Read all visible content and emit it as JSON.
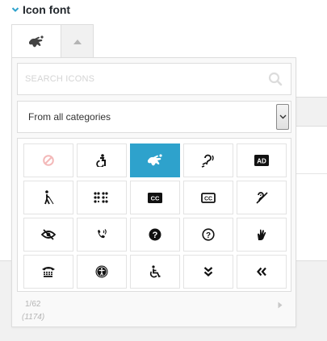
{
  "section": {
    "title": "Icon font"
  },
  "selector": {
    "current_icon": "sign-language-icon"
  },
  "search": {
    "placeholder": "SEARCH ICONS",
    "value": ""
  },
  "category": {
    "selected": "From all categories"
  },
  "icons": [
    "ban-icon",
    "accessible-person-icon",
    "sign-language-icon",
    "assistive-listening-icon",
    "audio-description-icon",
    "blind-icon",
    "braille-icon",
    "closed-captioning-icon",
    "closed-captioning-outline-icon",
    "deaf-icon",
    "low-vision-icon",
    "volume-control-phone-icon",
    "question-circle-icon",
    "question-circle-outline-icon",
    "sign-language-hand-icon",
    "tty-icon",
    "universal-access-icon",
    "wheelchair-icon",
    "angle-double-down-icon",
    "angle-double-left-icon"
  ],
  "selected_icon": "sign-language-icon",
  "pager": {
    "page": "1/62",
    "total": "(1174)"
  },
  "colors": {
    "accent": "#2ea2cc",
    "section_chevron": "#2ea2cc",
    "disabled_icon": "#f3b8b8"
  }
}
